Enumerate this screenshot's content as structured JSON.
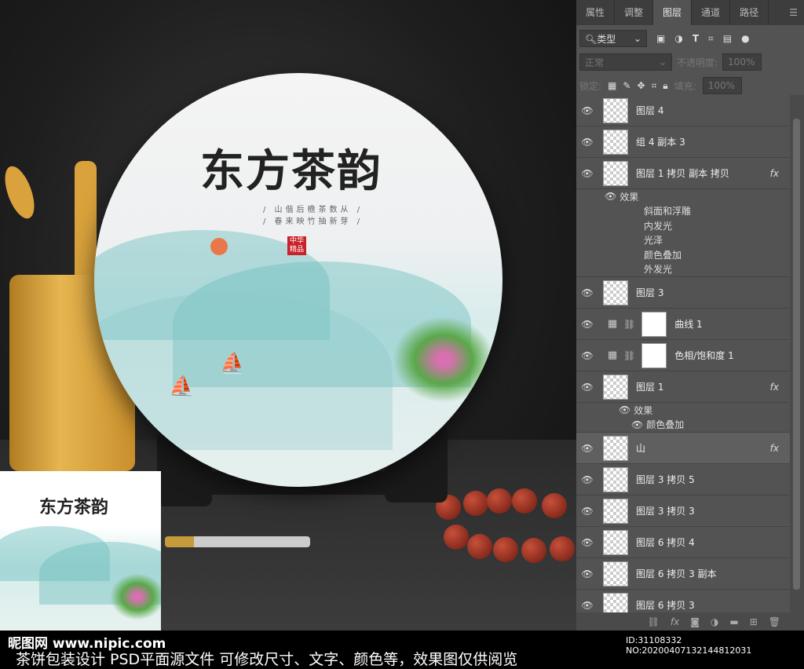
{
  "panel": {
    "tabs": [
      "属性",
      "调整",
      "图层",
      "通道",
      "路径"
    ],
    "active_tab": "图层",
    "filter": "类型",
    "blend": "正常",
    "opacity_label": "不透明度:",
    "opacity": "100%",
    "lock_label": "锁定:",
    "fill_label": "填充:",
    "fill": "100%"
  },
  "layers": [
    {
      "name": "图层 4",
      "type": "pixel"
    },
    {
      "name": "组 4 副本 3",
      "type": "pixel"
    },
    {
      "name": "图层 1 拷贝 副本 拷贝",
      "type": "pixel",
      "fx": "fx",
      "effects": [
        "效果",
        "斜面和浮雕",
        "内发光",
        "光泽",
        "颜色叠加",
        "外发光"
      ]
    },
    {
      "name": "图层 3",
      "type": "pixel"
    },
    {
      "name": "曲线 1",
      "type": "adjustment",
      "icon": "curves-icon"
    },
    {
      "name": "色相/饱和度 1",
      "type": "adjustment",
      "icon": "hue-saturation-icon"
    },
    {
      "name": "图层 1",
      "type": "pixel",
      "fx": "fx",
      "effects": [
        "效果",
        "颜色叠加"
      ]
    },
    {
      "name": "山",
      "type": "pixel",
      "fx": "fx",
      "highlight": true
    },
    {
      "name": "图层 3 拷贝 5",
      "type": "pixel"
    },
    {
      "name": "图层 3 拷贝 3",
      "type": "pixel"
    },
    {
      "name": "图层 6 拷贝 4",
      "type": "pixel"
    },
    {
      "name": "图层 6 拷贝 3 副本",
      "type": "pixel"
    },
    {
      "name": "图层 6 拷贝 3",
      "type": "pixel"
    }
  ],
  "artwork": {
    "title": "东方茶韵",
    "poem": [
      "/ 山偕后檐茶数从 /",
      "/ 春来映竹抽新芽 /"
    ],
    "seal": "中华精品"
  },
  "footer": {
    "logo": "昵图网 www.nipic.com",
    "desc": "茶饼包装设计 PSD平面源文件 可修改尺寸、文字、颜色等，效果图仅供阅览",
    "id": "ID:31108332 NO:20200407132144812031"
  }
}
